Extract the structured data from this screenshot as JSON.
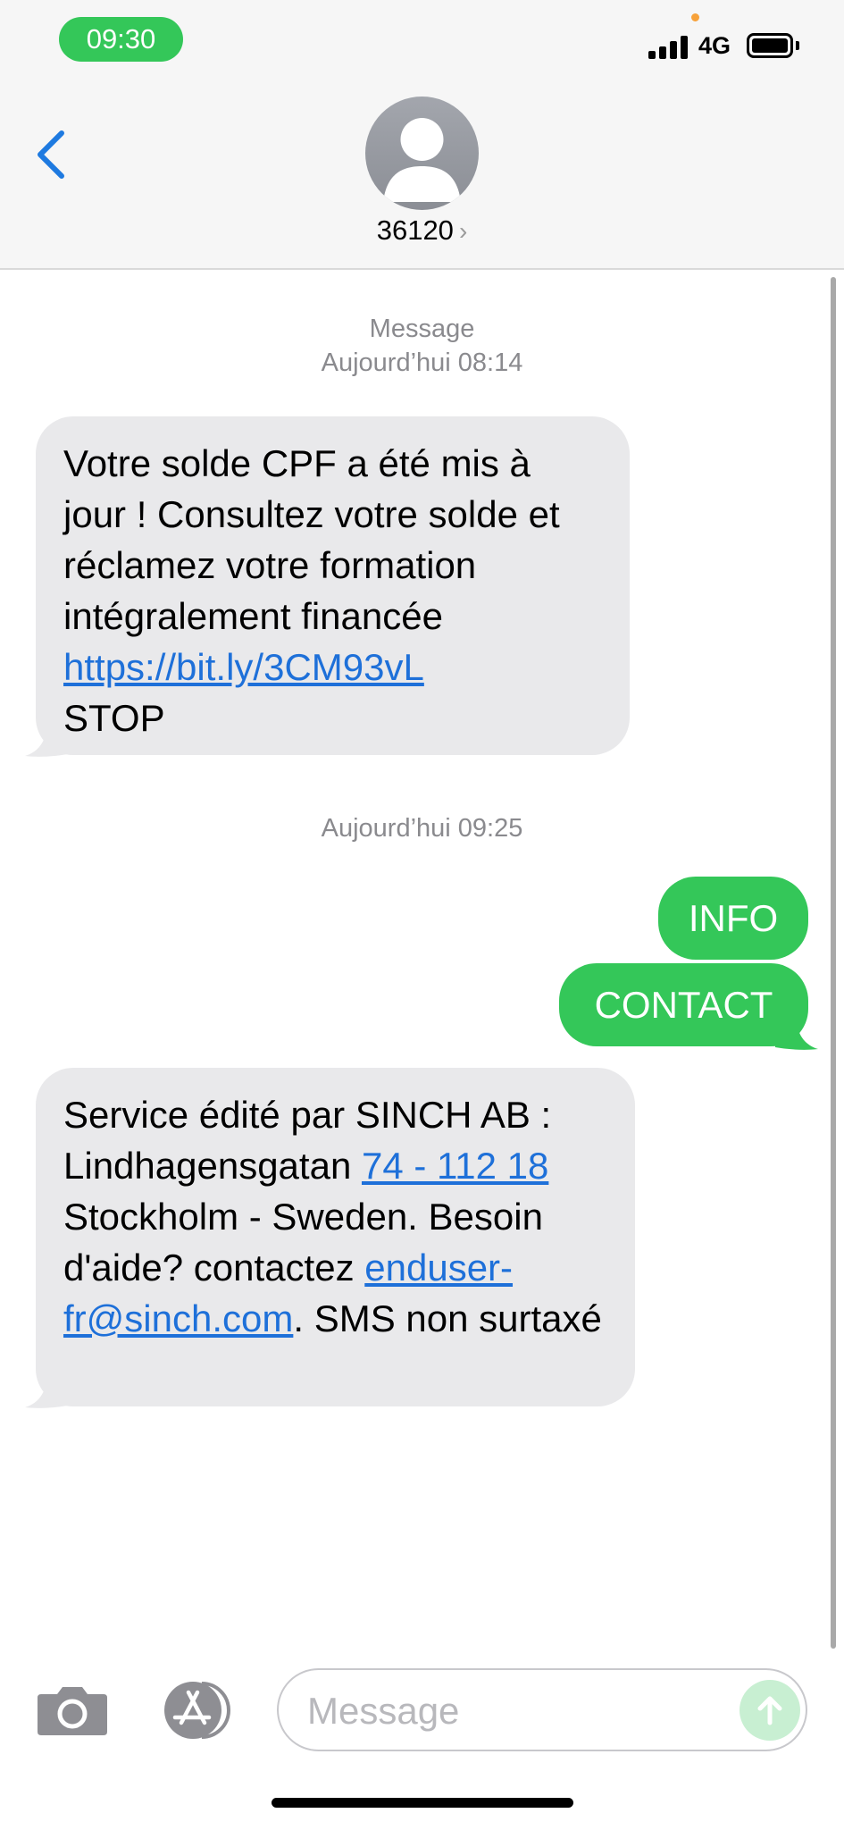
{
  "status_bar": {
    "time": "09:30",
    "network": "4G",
    "colors": {
      "time_pill": "#34c759",
      "privacy_dot": "#f7a23a"
    },
    "icons": [
      "cellular-signal-icon",
      "battery-icon"
    ]
  },
  "header": {
    "contact": "36120",
    "chevron": "›",
    "icons": [
      "back-chevron-icon",
      "contact-avatar-icon"
    ]
  },
  "conversation": {
    "first_stamp": {
      "label": "Message",
      "time": "Aujourd’hui 08:14"
    },
    "msg1": {
      "text": "Votre solde CPF a été mis à jour ! Consultez  votre solde et réclamez votre formation intégralement financée",
      "link": "https://bit.ly/3CM93vL",
      "tail_text": "STOP"
    },
    "second_stamp": {
      "label": "Aujourd’hui",
      "time": "09:25"
    },
    "sent": [
      "INFO",
      "CONTACT"
    ],
    "msg2": {
      "part1": "Service édité par SINCH AB : Lindhagensgatan ",
      "phone_link": "74 - 112 18",
      "part2": " Stockholm - Sweden. Besoin d'aide? contactez ",
      "email_link": "enduser-fr@sinch.com",
      "part3": ". SMS non surtaxé"
    },
    "colors": {
      "incoming": "#e9e9eb",
      "outgoing": "#34c759",
      "link": "#1e70d9"
    }
  },
  "composer": {
    "placeholder": "Message",
    "icons": [
      "camera-icon",
      "app-store-icon",
      "send-arrow-icon"
    ]
  }
}
